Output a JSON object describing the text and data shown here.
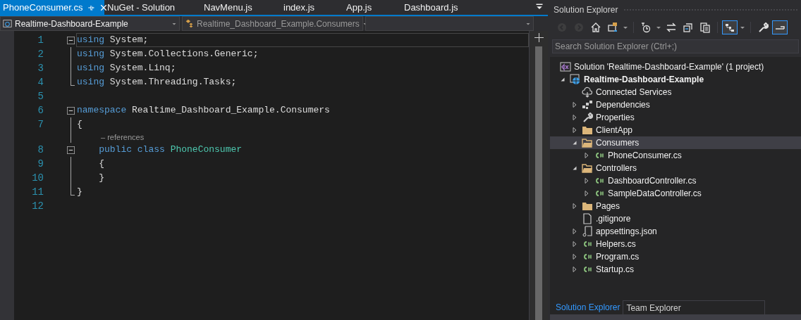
{
  "tabs": [
    {
      "label": "PhoneConsumer.cs",
      "selected": true,
      "pinnable": true
    },
    {
      "label": "NuGet - Solution",
      "selected": false,
      "pinnable": false
    },
    {
      "label": "NavMenu.js",
      "selected": false,
      "pinnable": false
    },
    {
      "label": "index.js",
      "selected": false,
      "pinnable": false
    },
    {
      "label": "App.js",
      "selected": false,
      "pinnable": false
    },
    {
      "label": "Dashboard.js",
      "selected": false,
      "pinnable": false
    }
  ],
  "navigation_bar": {
    "project": "Realtime-Dashboard-Example",
    "type": "Realtime_Dashboard_Example.Consumers"
  },
  "editor": {
    "lines": [
      {
        "kind": "code",
        "number": "1",
        "outline": {
          "kind": "start"
        },
        "current": true,
        "tokens": [
          {
            "kind": "keyword",
            "text": "using"
          },
          {
            "kind": "plain",
            "text": " System;"
          }
        ]
      },
      {
        "kind": "code",
        "number": "2",
        "outline": {
          "kind": "mid"
        },
        "current": false,
        "tokens": [
          {
            "kind": "keyword",
            "text": "using"
          },
          {
            "kind": "plain",
            "text": " System.Collections.Generic;"
          }
        ]
      },
      {
        "kind": "code",
        "number": "3",
        "outline": {
          "kind": "mid"
        },
        "current": false,
        "tokens": [
          {
            "kind": "keyword",
            "text": "using"
          },
          {
            "kind": "plain",
            "text": " System.Linq;"
          }
        ]
      },
      {
        "kind": "code",
        "number": "4",
        "outline": {
          "kind": "end"
        },
        "current": false,
        "tokens": [
          {
            "kind": "keyword",
            "text": "using"
          },
          {
            "kind": "plain",
            "text": " System.Threading.Tasks;"
          }
        ]
      },
      {
        "kind": "code",
        "number": "5",
        "current": false
      },
      {
        "kind": "code",
        "number": "6",
        "outline": {
          "kind": "start"
        },
        "current": false,
        "tokens": [
          {
            "kind": "keyword",
            "text": "namespace"
          },
          {
            "kind": "plain",
            "text": " Realtime_Dashboard_Example.Consumers"
          }
        ]
      },
      {
        "kind": "code",
        "number": "7",
        "outline": {
          "kind": "mid"
        },
        "current": false,
        "tokens": [
          {
            "kind": "plain",
            "text": "{"
          }
        ]
      },
      {
        "kind": "codelens",
        "outline": {
          "kind": "mid"
        },
        "text": "– references"
      },
      {
        "kind": "code",
        "number": "8",
        "outline": {
          "kind": "start"
        },
        "current": false,
        "tokens": [
          {
            "kind": "keyword",
            "text": "    public"
          },
          {
            "kind": "keyword",
            "text": " class"
          },
          {
            "kind": "type",
            "text": " PhoneConsumer"
          }
        ]
      },
      {
        "kind": "code",
        "number": "9",
        "outline": {
          "kind": "mid"
        },
        "current": false,
        "tokens": [
          {
            "kind": "plain",
            "text": "    {"
          }
        ]
      },
      {
        "kind": "code",
        "number": "10",
        "outline": {
          "kind": "mid"
        },
        "current": false,
        "tokens": [
          {
            "kind": "plain",
            "text": "    }"
          }
        ]
      },
      {
        "kind": "code",
        "number": "11",
        "outline": {
          "kind": "end"
        },
        "current": false,
        "tokens": [
          {
            "kind": "plain",
            "text": "}"
          }
        ]
      },
      {
        "kind": "code",
        "number": "12",
        "current": false
      }
    ]
  },
  "solution_explorer": {
    "title": "Solution Explorer",
    "toolbar": [
      {
        "kind": "back",
        "disabled": true,
        "selected": false
      },
      {
        "kind": "forward",
        "disabled": true,
        "selected": false
      },
      {
        "kind": "home",
        "disabled": false,
        "selected": false
      },
      {
        "kind": "switch-views",
        "disabled": false,
        "selected": false
      },
      {
        "kind": "caret",
        "disabled": false,
        "selected": false
      },
      {
        "kind": "separator"
      },
      {
        "kind": "pending-changes",
        "disabled": false,
        "selected": false
      },
      {
        "kind": "caret",
        "disabled": false,
        "selected": false
      },
      {
        "kind": "sync",
        "disabled": false,
        "selected": false
      },
      {
        "kind": "collapse",
        "disabled": false,
        "selected": false
      },
      {
        "kind": "copy",
        "disabled": false,
        "selected": false
      },
      {
        "kind": "separator"
      },
      {
        "kind": "tree",
        "disabled": false,
        "selected": true
      },
      {
        "kind": "caret",
        "disabled": false,
        "selected": false
      },
      {
        "kind": "separator"
      },
      {
        "kind": "properties",
        "disabled": false,
        "selected": false
      },
      {
        "kind": "preview",
        "disabled": false,
        "selected": true
      }
    ],
    "search": {
      "placeholder": "Search Solution Explorer (Ctrl+;)"
    },
    "tree": [
      {
        "label": "Solution 'Realtime-Dashboard-Example' (1 project)",
        "kind": "solution",
        "selected": false,
        "bold": false,
        "children": [
          {
            "label": "Realtime-Dashboard-Example",
            "kind": "project",
            "selected": false,
            "bold": true,
            "expanded": true,
            "children": [
              {
                "label": "Connected Services",
                "kind": "cloud",
                "selected": false,
                "bold": false
              },
              {
                "label": "Dependencies",
                "kind": "dependencies",
                "selected": false,
                "bold": false,
                "expanded": false
              },
              {
                "label": "Properties",
                "kind": "wrench",
                "selected": false,
                "bold": false,
                "expanded": false
              },
              {
                "label": "ClientApp",
                "kind": "folder",
                "selected": false,
                "bold": false,
                "expanded": false
              },
              {
                "label": "Consumers",
                "kind": "folder-open",
                "selected": true,
                "bold": false,
                "expanded": true,
                "children": [
                  {
                    "label": "PhoneConsumer.cs",
                    "kind": "csharp",
                    "selected": false,
                    "bold": false,
                    "expanded": false
                  }
                ]
              },
              {
                "label": "Controllers",
                "kind": "folder-open",
                "selected": false,
                "bold": false,
                "expanded": true,
                "children": [
                  {
                    "label": "DashboardController.cs",
                    "kind": "csharp",
                    "selected": false,
                    "bold": false,
                    "expanded": false
                  },
                  {
                    "label": "SampleDataController.cs",
                    "kind": "csharp",
                    "selected": false,
                    "bold": false,
                    "expanded": false
                  }
                ]
              },
              {
                "label": "Pages",
                "kind": "folder",
                "selected": false,
                "bold": false,
                "expanded": false
              },
              {
                "label": ".gitignore",
                "kind": "file",
                "selected": false,
                "bold": false
              },
              {
                "label": "appsettings.json",
                "kind": "json",
                "selected": false,
                "bold": false,
                "expanded": false
              },
              {
                "label": "Helpers.cs",
                "kind": "csharp",
                "selected": false,
                "bold": false,
                "expanded": false
              },
              {
                "label": "Program.cs",
                "kind": "csharp",
                "selected": false,
                "bold": false,
                "expanded": false
              },
              {
                "label": "Startup.cs",
                "kind": "csharp",
                "selected": false,
                "bold": false,
                "expanded": false
              }
            ]
          }
        ]
      }
    ],
    "bottom_tabs": [
      {
        "label": "Solution Explorer",
        "selected": true
      },
      {
        "label": "Team Explorer",
        "selected": false
      }
    ]
  }
}
